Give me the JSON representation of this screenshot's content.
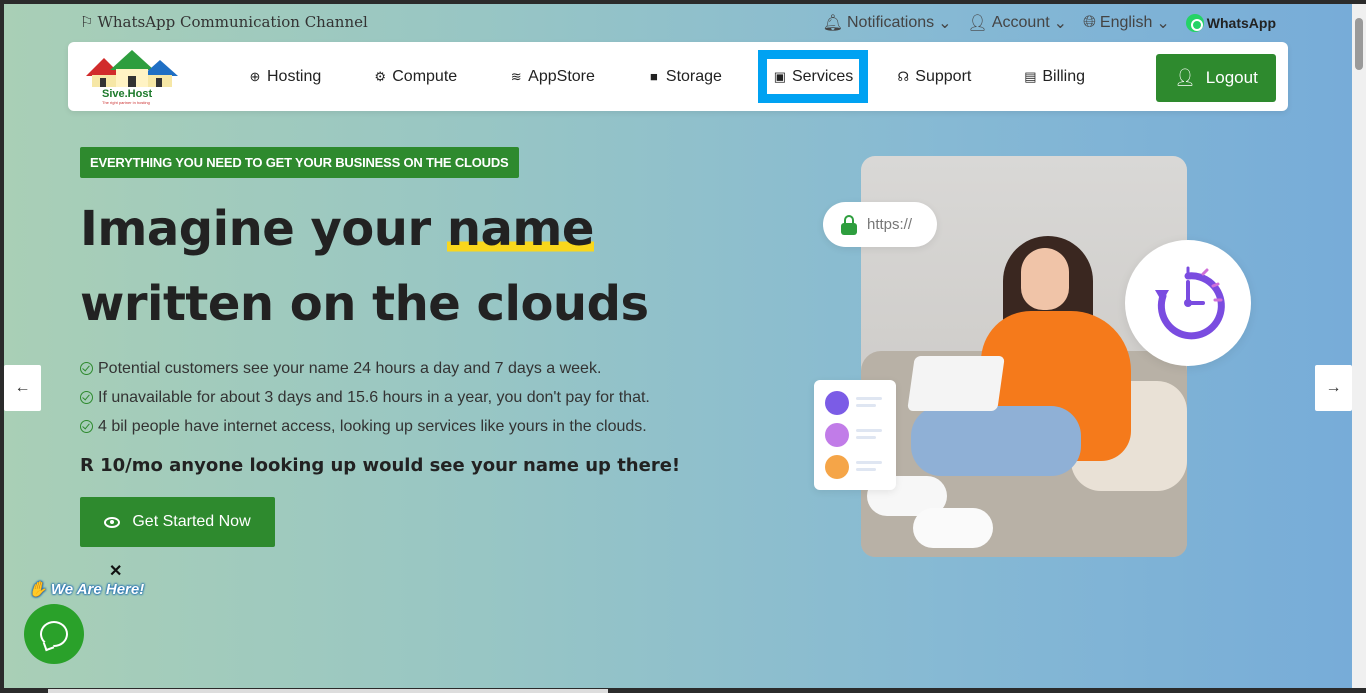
{
  "topbar": {
    "channel": "WhatsApp Communication Channel",
    "notifications": "Notifications",
    "account": "Account",
    "language": "English",
    "whatsapp": "WhatsApp"
  },
  "logo": {
    "name": "Sive.Host",
    "tagline": "The right partner in hosting"
  },
  "nav": {
    "items": [
      {
        "label": "Hosting",
        "icon": "globe-icon"
      },
      {
        "label": "Compute",
        "icon": "gear-icon"
      },
      {
        "label": "AppStore",
        "icon": "database-icon"
      },
      {
        "label": "Storage",
        "icon": "box-icon"
      },
      {
        "label": "Services",
        "icon": "gift-icon"
      },
      {
        "label": "Support",
        "icon": "headset-icon"
      },
      {
        "label": "Billing",
        "icon": "invoice-icon"
      }
    ],
    "active": "Services",
    "logout": "Logout"
  },
  "hero": {
    "badge": "EVERYTHING YOU NEED TO GET YOUR BUSINESS ON THE CLOUDS",
    "headline_part1": "Imagine your ",
    "headline_highlight": "name",
    "headline_line2": "written on the clouds",
    "checks": [
      "Potential customers see your name 24 hours a day and 7 days a week.",
      "If unavailable for about 3 days and 15.6 hours in a year, you don't pay for that.",
      "4 bil people have internet access, looking up services like yours in the clouds."
    ],
    "price": "R 10/mo anyone looking up would see your name up there!",
    "cta": "Get Started Now",
    "https_label": "https://"
  },
  "carousel": {
    "prev": "←",
    "next": "→"
  },
  "chat": {
    "title": "We Are Here!",
    "close": "✕"
  },
  "colors": {
    "brand_green": "#2e8a2e",
    "active_outline": "#00a2f2",
    "highlight": "#f9d71c"
  }
}
